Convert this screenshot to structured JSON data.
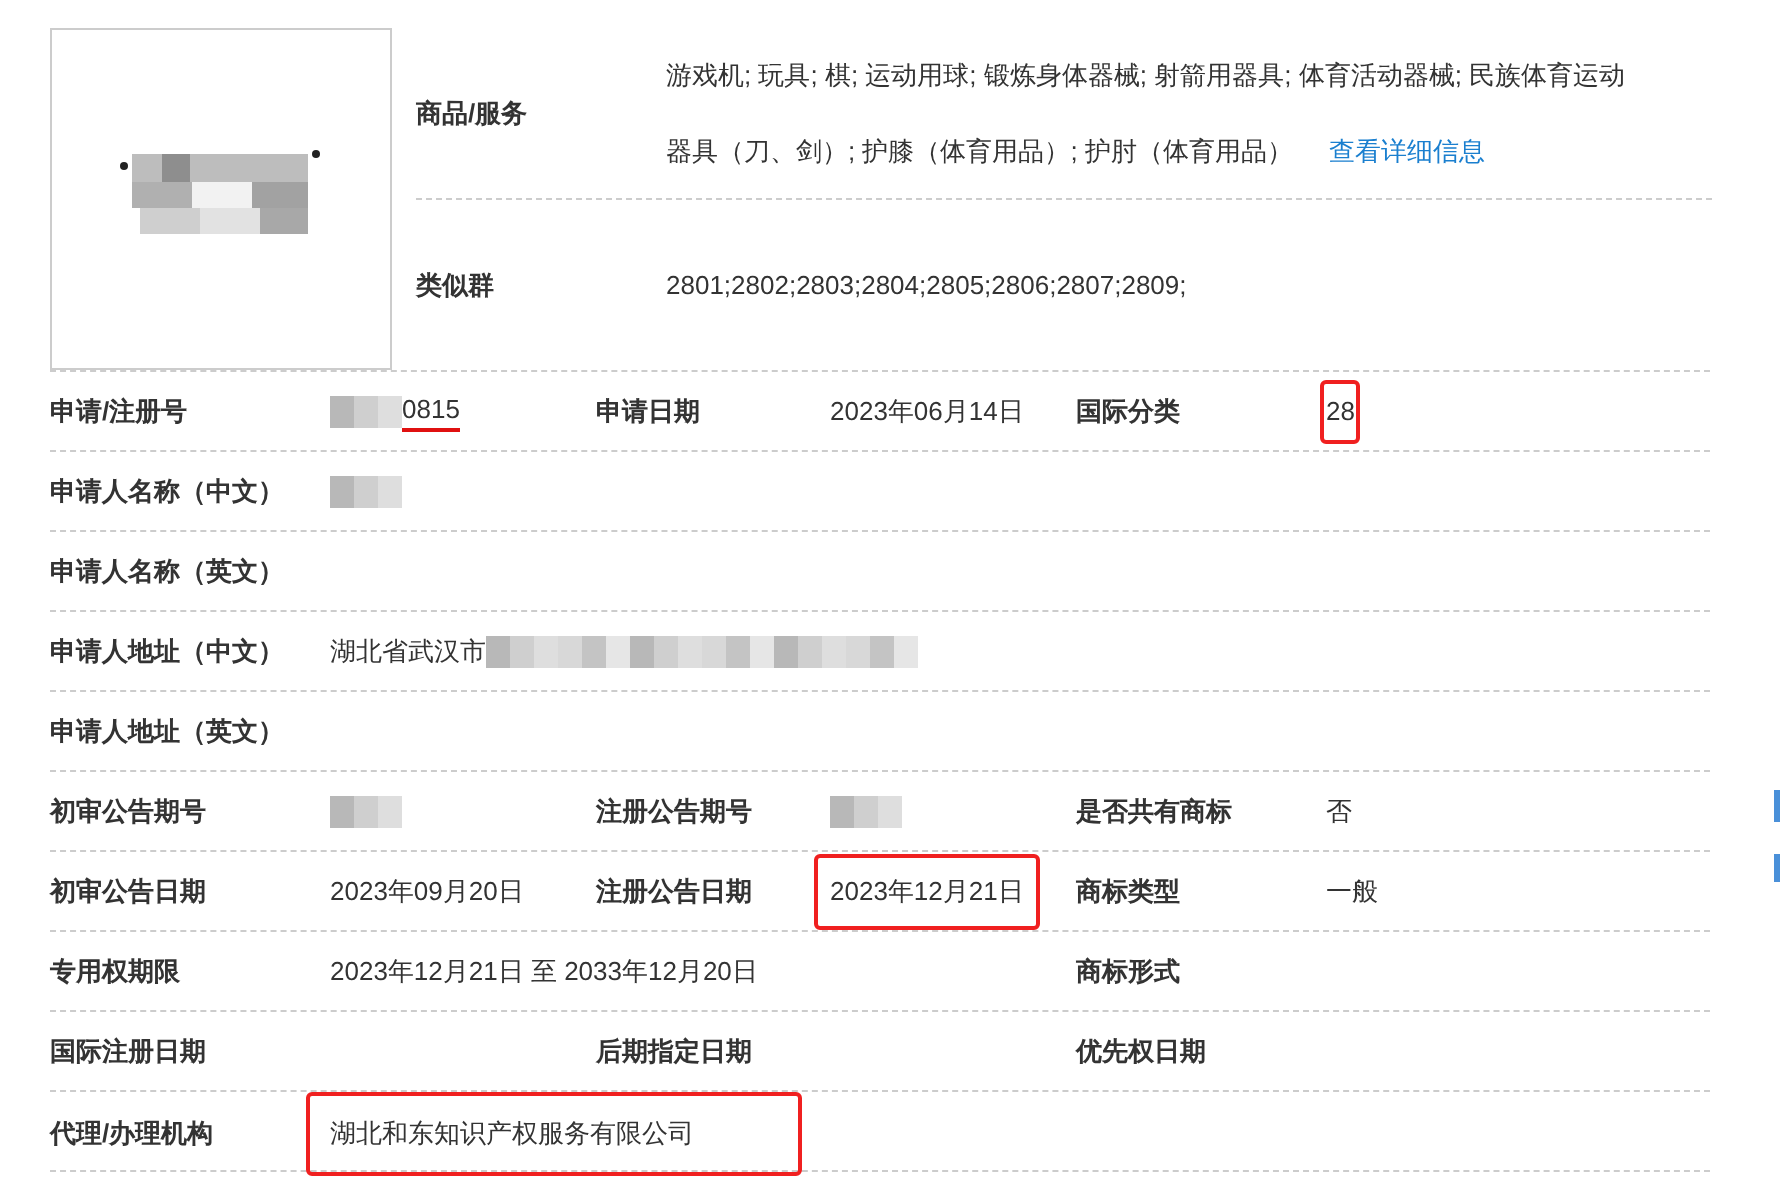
{
  "goods_services": {
    "label": "商品/服务",
    "lines": [
      "游戏机; 玩具; 棋; 运动用球; 锻炼身体器械; 射箭用器具; 体育活动器械; 民族体育运动",
      "器具（刀、剑）; 护膝（体育用品）; 护肘（体育用品）"
    ],
    "link": "查看详细信息"
  },
  "similar_group": {
    "label": "类似群",
    "value": "2801;2802;2803;2804;2805;2806;2807;2809;"
  },
  "rows": [
    {
      "cells": [
        {
          "label": "申请/注册号",
          "value": "0815",
          "redacted_before": true,
          "underlined": true
        },
        {
          "label": "申请日期",
          "value": "2023年06月14日"
        },
        {
          "label": "国际分类",
          "value": "28",
          "boxed": true
        }
      ]
    },
    {
      "cells": [
        {
          "label": "申请人名称（中文）",
          "redacted": true
        }
      ]
    },
    {
      "cells": [
        {
          "label": "申请人名称（英文）"
        }
      ]
    },
    {
      "cells": [
        {
          "label": "申请人地址（中文）",
          "value": "湖北省武汉市",
          "redacted_after": true
        }
      ]
    },
    {
      "cells": [
        {
          "label": "申请人地址（英文）"
        }
      ]
    },
    {
      "cells": [
        {
          "label": "初审公告期号",
          "redacted": true
        },
        {
          "label": "注册公告期号",
          "redacted": true
        },
        {
          "label": "是否共有商标",
          "value": "否"
        }
      ]
    },
    {
      "cells": [
        {
          "label": "初审公告日期",
          "value": "2023年09月20日"
        },
        {
          "label": "注册公告日期",
          "value": "2023年12月21日",
          "boxed": true
        },
        {
          "label": "商标类型",
          "value": "一般"
        }
      ]
    },
    {
      "cells": [
        {
          "label": "专用权期限",
          "value": "2023年12月21日 至 2033年12月20日"
        },
        {
          "label": "商标形式"
        }
      ]
    },
    {
      "cells": [
        {
          "label": "国际注册日期"
        },
        {
          "label": "后期指定日期"
        },
        {
          "label": "优先权日期"
        }
      ]
    },
    {
      "cells": [
        {
          "label": "代理/办理机构",
          "value": "湖北和东知识产权服务有限公司",
          "boxed": true
        }
      ]
    }
  ]
}
